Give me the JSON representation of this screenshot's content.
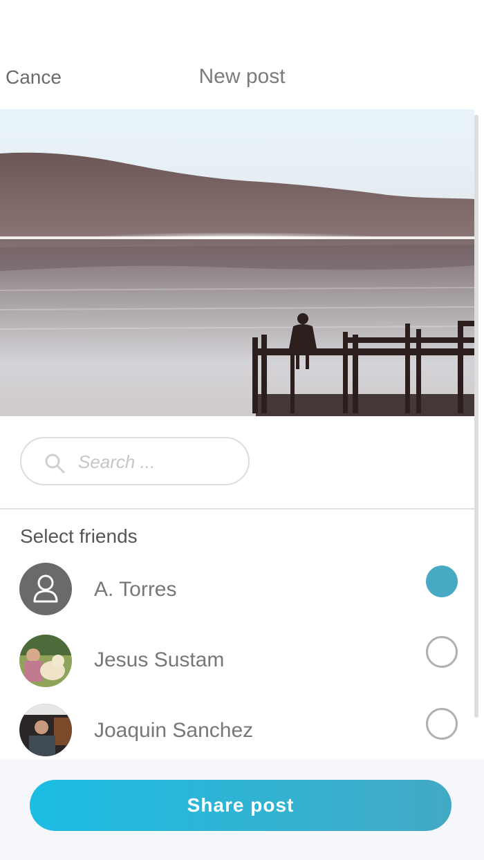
{
  "header": {
    "cancel_label": "Cance",
    "title": "New post"
  },
  "search": {
    "placeholder": "Search ..."
  },
  "friends_section": {
    "title": "Select friends"
  },
  "friends": [
    {
      "name": "A. Torres",
      "selected": true
    },
    {
      "name": "Jesus Sustam",
      "selected": false
    },
    {
      "name": "Joaquin Sanchez",
      "selected": false
    }
  ],
  "footer": {
    "share_label": "Share post"
  },
  "colors": {
    "accent": "#47a9c3",
    "button_start": "#1cbde3",
    "button_end": "#42a9c4",
    "avatar_default": "#6a6a6a"
  },
  "icons": {
    "search": "search-icon",
    "default_avatar": "user-icon"
  }
}
